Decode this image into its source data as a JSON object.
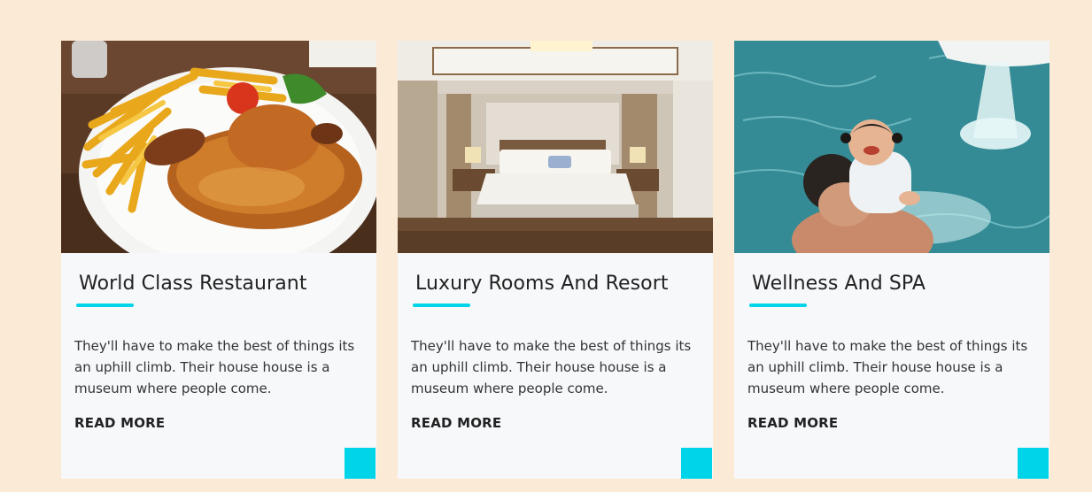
{
  "theme": {
    "accent": "#00d4e8",
    "page_background": "#fbead6",
    "card_background": "#f7f8fa"
  },
  "cards": [
    {
      "image": "roast-chicken-and-fries-photo",
      "title": "World Class Restaurant",
      "text": "They'll have to make the best of things its an uphill climb. Their house house is a museum where people come.",
      "read_more": "READ MORE"
    },
    {
      "image": "luxury-hotel-bedroom-photo",
      "title": "Luxury Rooms And Resort",
      "text": "They'll have to make the best of things its an uphill climb. Their house house is a museum where people come.",
      "read_more": "READ MORE"
    },
    {
      "image": "father-and-child-in-spa-pool-photo",
      "title": "Wellness And SPA",
      "text": "They'll have to make the best of things its an uphill climb. Their house house is a museum where people come.",
      "read_more": "READ MORE"
    }
  ]
}
